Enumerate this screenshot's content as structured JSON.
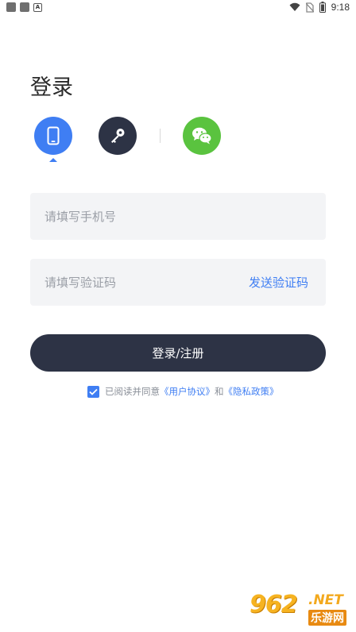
{
  "status_bar": {
    "time": "9:18",
    "left_icons": [
      "notification-icon",
      "notification-icon",
      "a-icon"
    ],
    "a_glyph": "A",
    "right_icons": [
      "wifi-icon",
      "no-sim-icon",
      "battery-icon"
    ]
  },
  "title": "登录",
  "login_methods": [
    {
      "name": "phone",
      "icon": "phone-icon",
      "color": "#3f7ef3",
      "active": true
    },
    {
      "name": "password",
      "icon": "key-icon",
      "color": "#2d3345",
      "active": false
    },
    {
      "name": "wechat",
      "icon": "wechat-icon",
      "color": "#5ac33f",
      "active": false
    }
  ],
  "form": {
    "phone_placeholder": "请填写手机号",
    "code_placeholder": "请填写验证码",
    "send_code_label": "发送验证码",
    "submit_label": "登录/注册"
  },
  "agreement": {
    "checked": true,
    "prefix": "已阅读并同意",
    "user_agreement": "《用户协议》",
    "conjunction": "和",
    "privacy_policy": "《隐私政策》"
  },
  "watermark": {
    "number": "962",
    "suffix": ".NET",
    "site_name": "乐游网"
  },
  "colors": {
    "accent": "#3f7ef3",
    "dark": "#2d3345",
    "wechat": "#5ac33f",
    "field_bg": "#f3f4f6"
  }
}
